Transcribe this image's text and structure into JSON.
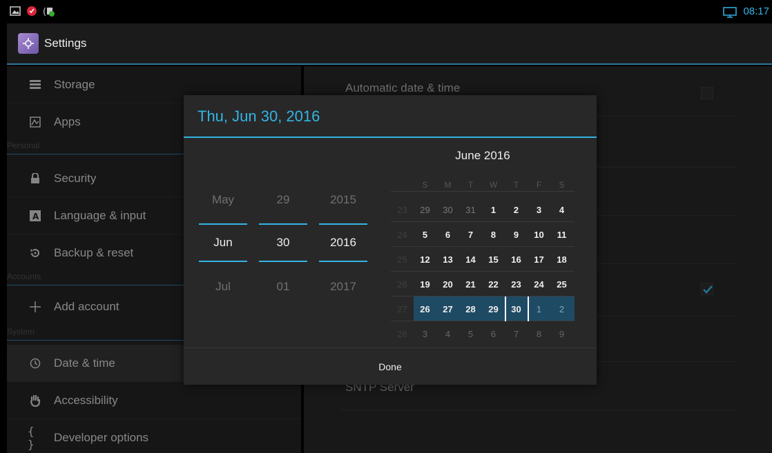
{
  "status_bar": {
    "icons": [
      "gallery-icon",
      "warning-icon",
      "usb-call-icon"
    ],
    "time": "08:17"
  },
  "action_bar": {
    "title": "Settings"
  },
  "sidebar": {
    "items": [
      {
        "label": "Storage",
        "icon": "storage-icon"
      },
      {
        "label": "Apps",
        "icon": "apps-icon"
      },
      {
        "header": "Personal"
      },
      {
        "label": "Security",
        "icon": "lock-icon"
      },
      {
        "label": "Language & input",
        "icon": "keyboard-icon"
      },
      {
        "label": "Backup & reset",
        "icon": "backup-icon"
      },
      {
        "header": "Accounts"
      },
      {
        "label": "Add account",
        "icon": "plus-icon"
      },
      {
        "header": "System"
      },
      {
        "label": "Date & time",
        "icon": "clock-icon",
        "selected": true
      },
      {
        "label": "Accessibility",
        "icon": "hand-icon"
      },
      {
        "label": "Developer options",
        "icon": "braces-icon"
      }
    ]
  },
  "right_pane": {
    "automatic_label": "Automatic date & time",
    "sntp_label": "SNTP Server"
  },
  "dialog": {
    "title": "Thu, Jun 30, 2016",
    "spinner": {
      "month": {
        "prev": "May",
        "current": "Jun",
        "next": "Jul"
      },
      "day": {
        "prev": "29",
        "current": "30",
        "next": "01"
      },
      "year": {
        "prev": "2015",
        "current": "2016",
        "next": "2017"
      }
    },
    "calendar": {
      "title": "June 2016",
      "weekdays": [
        "S",
        "M",
        "T",
        "W",
        "T",
        "F",
        "S"
      ],
      "weeks": [
        {
          "wk": "23",
          "days": [
            "29",
            "30",
            "31",
            "1",
            "2",
            "3",
            "4"
          ]
        },
        {
          "wk": "24",
          "days": [
            "5",
            "6",
            "7",
            "8",
            "9",
            "10",
            "11"
          ]
        },
        {
          "wk": "25",
          "days": [
            "12",
            "13",
            "14",
            "15",
            "16",
            "17",
            "18"
          ]
        },
        {
          "wk": "26",
          "days": [
            "19",
            "20",
            "21",
            "22",
            "23",
            "24",
            "25"
          ]
        },
        {
          "wk": "27",
          "days": [
            "26",
            "27",
            "28",
            "29",
            "30",
            "1",
            "2"
          ]
        },
        {
          "wk": "28",
          "days": [
            "3",
            "4",
            "5",
            "6",
            "7",
            "8",
            "9"
          ]
        }
      ],
      "selected_day": "30"
    },
    "done_label": "Done"
  },
  "colors": {
    "accent": "#33b5e5",
    "selection_row": "#1f4a63"
  }
}
